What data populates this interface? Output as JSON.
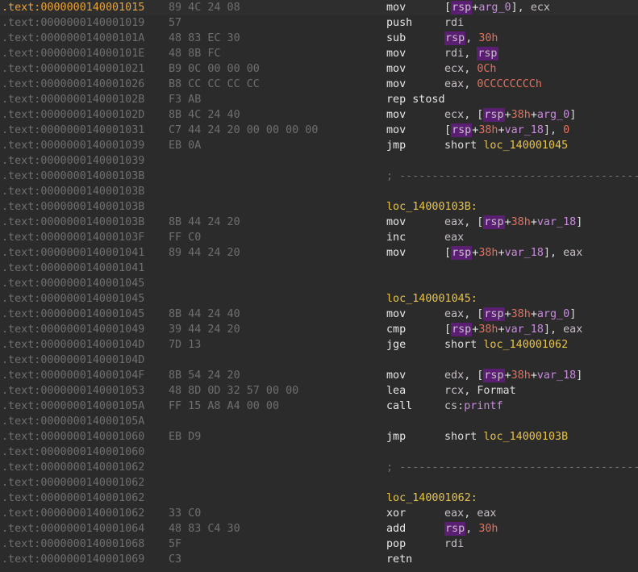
{
  "rows": [
    {
      "addr": ".text:0000000140001015",
      "bytes": "89 4C 24 08",
      "current": true,
      "code": {
        "mnemonic": "mov",
        "operands": [
          {
            "t": "[",
            "k": "p"
          },
          {
            "t": "rsp",
            "k": "reg",
            "hl": true
          },
          {
            "t": "+",
            "k": "p"
          },
          {
            "t": "arg_0",
            "k": "var"
          },
          {
            "t": "], ",
            "k": "p"
          },
          {
            "t": "ecx",
            "k": "reg"
          }
        ]
      }
    },
    {
      "addr": ".text:0000000140001019",
      "bytes": "57",
      "code": {
        "mnemonic": "push",
        "operands": [
          {
            "t": "rdi",
            "k": "reg"
          }
        ]
      }
    },
    {
      "addr": ".text:000000014000101A",
      "bytes": "48 83 EC 30",
      "code": {
        "mnemonic": "sub",
        "operands": [
          {
            "t": "rsp",
            "k": "reg",
            "hl": true
          },
          {
            "t": ", ",
            "k": "p"
          },
          {
            "t": "30h",
            "k": "num"
          }
        ]
      }
    },
    {
      "addr": ".text:000000014000101E",
      "bytes": "48 8B FC",
      "code": {
        "mnemonic": "mov",
        "operands": [
          {
            "t": "rdi",
            "k": "reg"
          },
          {
            "t": ", ",
            "k": "p"
          },
          {
            "t": "rsp",
            "k": "reg",
            "hl": true
          }
        ]
      }
    },
    {
      "addr": ".text:0000000140001021",
      "bytes": "B9 0C 00 00 00",
      "code": {
        "mnemonic": "mov",
        "operands": [
          {
            "t": "ecx",
            "k": "reg"
          },
          {
            "t": ", ",
            "k": "p"
          },
          {
            "t": "0Ch",
            "k": "num"
          }
        ]
      }
    },
    {
      "addr": ".text:0000000140001026",
      "bytes": "B8 CC CC CC CC",
      "code": {
        "mnemonic": "mov",
        "operands": [
          {
            "t": "eax",
            "k": "reg"
          },
          {
            "t": ", ",
            "k": "p"
          },
          {
            "t": "0CCCCCCCCh",
            "k": "num"
          }
        ]
      }
    },
    {
      "addr": ".text:000000014000102B",
      "bytes": "F3 AB",
      "code": {
        "mnemonic": "rep stosd",
        "operands": []
      }
    },
    {
      "addr": ".text:000000014000102D",
      "bytes": "8B 4C 24 40",
      "code": {
        "mnemonic": "mov",
        "operands": [
          {
            "t": "ecx",
            "k": "reg"
          },
          {
            "t": ", [",
            "k": "p"
          },
          {
            "t": "rsp",
            "k": "reg",
            "hl": true
          },
          {
            "t": "+",
            "k": "p"
          },
          {
            "t": "38h",
            "k": "num"
          },
          {
            "t": "+",
            "k": "p"
          },
          {
            "t": "arg_0",
            "k": "var"
          },
          {
            "t": "]",
            "k": "p"
          }
        ]
      }
    },
    {
      "addr": ".text:0000000140001031",
      "bytes": "C7 44 24 20 00 00 00 00",
      "code": {
        "mnemonic": "mov",
        "operands": [
          {
            "t": "[",
            "k": "p"
          },
          {
            "t": "rsp",
            "k": "reg",
            "hl": true
          },
          {
            "t": "+",
            "k": "p"
          },
          {
            "t": "38h",
            "k": "num"
          },
          {
            "t": "+",
            "k": "p"
          },
          {
            "t": "var_18",
            "k": "var"
          },
          {
            "t": "], ",
            "k": "p"
          },
          {
            "t": "0",
            "k": "num"
          }
        ]
      }
    },
    {
      "addr": ".text:0000000140001039",
      "bytes": "EB 0A",
      "code": {
        "mnemonic": "jmp",
        "operands": [
          {
            "t": "short ",
            "k": "kw"
          },
          {
            "t": "loc_140001045",
            "k": "lbl"
          }
        ]
      }
    },
    {
      "addr": ".text:0000000140001039",
      "bytes": "",
      "code": null
    },
    {
      "addr": ".text:000000014000103B",
      "bytes": "",
      "sep": "; ---------------------------------------"
    },
    {
      "addr": ".text:000000014000103B",
      "bytes": "",
      "code": null
    },
    {
      "addr": ".text:000000014000103B",
      "bytes": "",
      "label": "loc_14000103B:"
    },
    {
      "addr": ".text:000000014000103B",
      "bytes": "8B 44 24 20",
      "code": {
        "mnemonic": "mov",
        "operands": [
          {
            "t": "eax",
            "k": "reg"
          },
          {
            "t": ", [",
            "k": "p"
          },
          {
            "t": "rsp",
            "k": "reg",
            "hl": true
          },
          {
            "t": "+",
            "k": "p"
          },
          {
            "t": "38h",
            "k": "num"
          },
          {
            "t": "+",
            "k": "p"
          },
          {
            "t": "var_18",
            "k": "var"
          },
          {
            "t": "]",
            "k": "p"
          }
        ]
      }
    },
    {
      "addr": ".text:000000014000103F",
      "bytes": "FF C0",
      "code": {
        "mnemonic": "inc",
        "operands": [
          {
            "t": "eax",
            "k": "reg"
          }
        ]
      }
    },
    {
      "addr": ".text:0000000140001041",
      "bytes": "89 44 24 20",
      "code": {
        "mnemonic": "mov",
        "operands": [
          {
            "t": "[",
            "k": "p"
          },
          {
            "t": "rsp",
            "k": "reg",
            "hl": true
          },
          {
            "t": "+",
            "k": "p"
          },
          {
            "t": "38h",
            "k": "num"
          },
          {
            "t": "+",
            "k": "p"
          },
          {
            "t": "var_18",
            "k": "var"
          },
          {
            "t": "], ",
            "k": "p"
          },
          {
            "t": "eax",
            "k": "reg"
          }
        ]
      }
    },
    {
      "addr": ".text:0000000140001041",
      "bytes": "",
      "code": null
    },
    {
      "addr": ".text:0000000140001045",
      "bytes": "",
      "code": null
    },
    {
      "addr": ".text:0000000140001045",
      "bytes": "",
      "label": "loc_140001045:"
    },
    {
      "addr": ".text:0000000140001045",
      "bytes": "8B 44 24 40",
      "code": {
        "mnemonic": "mov",
        "operands": [
          {
            "t": "eax",
            "k": "reg"
          },
          {
            "t": ", [",
            "k": "p"
          },
          {
            "t": "rsp",
            "k": "reg",
            "hl": true
          },
          {
            "t": "+",
            "k": "p"
          },
          {
            "t": "38h",
            "k": "num"
          },
          {
            "t": "+",
            "k": "p"
          },
          {
            "t": "arg_0",
            "k": "var"
          },
          {
            "t": "]",
            "k": "p"
          }
        ]
      }
    },
    {
      "addr": ".text:0000000140001049",
      "bytes": "39 44 24 20",
      "code": {
        "mnemonic": "cmp",
        "operands": [
          {
            "t": "[",
            "k": "p"
          },
          {
            "t": "rsp",
            "k": "reg",
            "hl": true
          },
          {
            "t": "+",
            "k": "p"
          },
          {
            "t": "38h",
            "k": "num"
          },
          {
            "t": "+",
            "k": "p"
          },
          {
            "t": "var_18",
            "k": "var"
          },
          {
            "t": "], ",
            "k": "p"
          },
          {
            "t": "eax",
            "k": "reg"
          }
        ]
      }
    },
    {
      "addr": ".text:000000014000104D",
      "bytes": "7D 13",
      "code": {
        "mnemonic": "jge",
        "operands": [
          {
            "t": "short ",
            "k": "kw"
          },
          {
            "t": "loc_140001062",
            "k": "lbl"
          }
        ]
      }
    },
    {
      "addr": ".text:000000014000104D",
      "bytes": "",
      "code": null
    },
    {
      "addr": ".text:000000014000104F",
      "bytes": "8B 54 24 20",
      "code": {
        "mnemonic": "mov",
        "operands": [
          {
            "t": "edx",
            "k": "reg"
          },
          {
            "t": ", [",
            "k": "p"
          },
          {
            "t": "rsp",
            "k": "reg",
            "hl": true
          },
          {
            "t": "+",
            "k": "p"
          },
          {
            "t": "38h",
            "k": "num"
          },
          {
            "t": "+",
            "k": "p"
          },
          {
            "t": "var_18",
            "k": "var"
          },
          {
            "t": "]",
            "k": "p"
          }
        ]
      }
    },
    {
      "addr": ".text:0000000140001053",
      "bytes": "48 8D 0D 32 57 00 00",
      "code": {
        "mnemonic": "lea",
        "operands": [
          {
            "t": "rcx",
            "k": "reg"
          },
          {
            "t": ", ",
            "k": "p"
          },
          {
            "t": "Format",
            "k": "kw"
          }
        ]
      }
    },
    {
      "addr": ".text:000000014000105A",
      "bytes": "FF 15 A8 A4 00 00",
      "code": {
        "mnemonic": "call",
        "operands": [
          {
            "t": "cs:",
            "k": "reg"
          },
          {
            "t": "printf",
            "k": "fn"
          }
        ]
      }
    },
    {
      "addr": ".text:000000014000105A",
      "bytes": "",
      "code": null
    },
    {
      "addr": ".text:0000000140001060",
      "bytes": "EB D9",
      "code": {
        "mnemonic": "jmp",
        "operands": [
          {
            "t": "short ",
            "k": "kw"
          },
          {
            "t": "loc_14000103B",
            "k": "lbl"
          }
        ]
      }
    },
    {
      "addr": ".text:0000000140001060",
      "bytes": "",
      "code": null
    },
    {
      "addr": ".text:0000000140001062",
      "bytes": "",
      "sep": "; ---------------------------------------"
    },
    {
      "addr": ".text:0000000140001062",
      "bytes": "",
      "code": null
    },
    {
      "addr": ".text:0000000140001062",
      "bytes": "",
      "label": "loc_140001062:"
    },
    {
      "addr": ".text:0000000140001062",
      "bytes": "33 C0",
      "code": {
        "mnemonic": "xor",
        "operands": [
          {
            "t": "eax",
            "k": "reg"
          },
          {
            "t": ", ",
            "k": "p"
          },
          {
            "t": "eax",
            "k": "reg"
          }
        ]
      }
    },
    {
      "addr": ".text:0000000140001064",
      "bytes": "48 83 C4 30",
      "code": {
        "mnemonic": "add",
        "operands": [
          {
            "t": "rsp",
            "k": "reg",
            "hl": true
          },
          {
            "t": ", ",
            "k": "p"
          },
          {
            "t": "30h",
            "k": "num"
          }
        ]
      }
    },
    {
      "addr": ".text:0000000140001068",
      "bytes": "5F",
      "code": {
        "mnemonic": "pop",
        "operands": [
          {
            "t": "rdi",
            "k": "reg"
          }
        ]
      }
    },
    {
      "addr": ".text:0000000140001069",
      "bytes": "C3",
      "code": {
        "mnemonic": "retn",
        "operands": []
      }
    }
  ],
  "colors": {
    "background": "#2b2b2b",
    "address": "#6f6f6f",
    "current_address": "#e8a23a",
    "label": "#e8c346",
    "register_highlight": "#5a1f73",
    "number": "#e76f5b",
    "variable": "#c98ae0"
  }
}
